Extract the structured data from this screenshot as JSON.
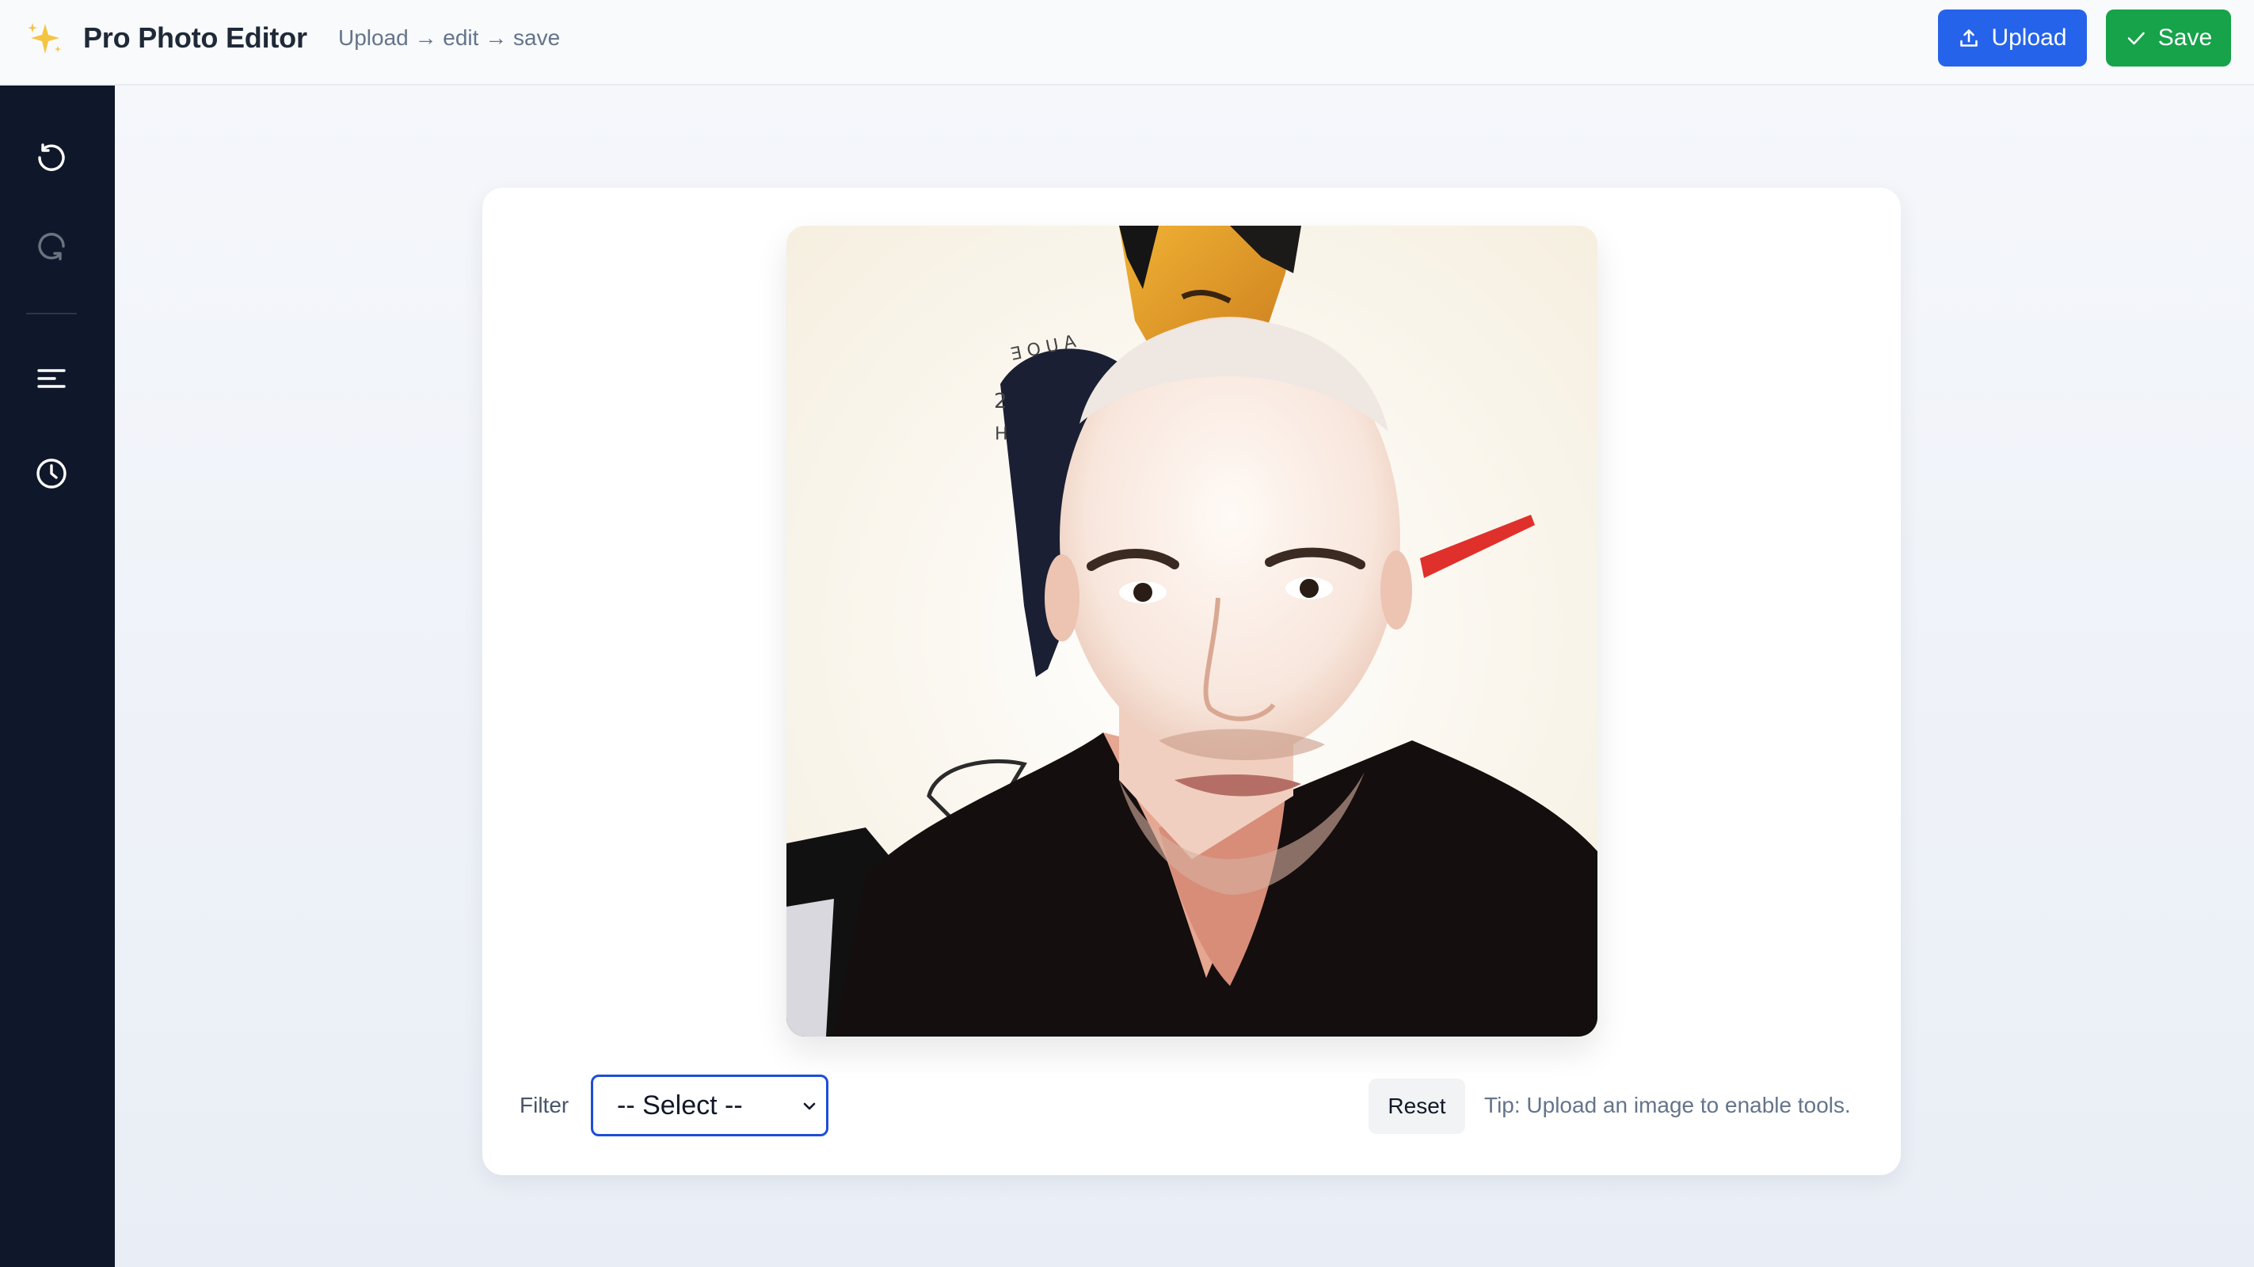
{
  "app": {
    "title": "Pro Photo Editor",
    "breadcrumb": "Upload → edit → save",
    "brand_icon": "sparkles-icon"
  },
  "header": {
    "upload_label": "Upload",
    "upload_icon": "upload-icon",
    "save_label": "Save",
    "save_icon": "check-icon"
  },
  "sidebar": {
    "items": [
      {
        "icon": "rotate-left-icon",
        "state": "active"
      },
      {
        "icon": "rotate-right-icon",
        "state": "dimmed"
      },
      {
        "icon": "align-left-icon",
        "state": "active"
      },
      {
        "icon": "clock-icon",
        "state": "active"
      }
    ]
  },
  "editor": {
    "filter_label": "Filter",
    "filter_selected": "-- Select --",
    "reset_label": "Reset",
    "tip": "Tip: Upload an image to enable tools."
  },
  "colors": {
    "upload_button": "#2563eb",
    "save_button": "#16a34a",
    "sidebar_bg": "#0f172a",
    "select_border": "#1d4ed8"
  }
}
